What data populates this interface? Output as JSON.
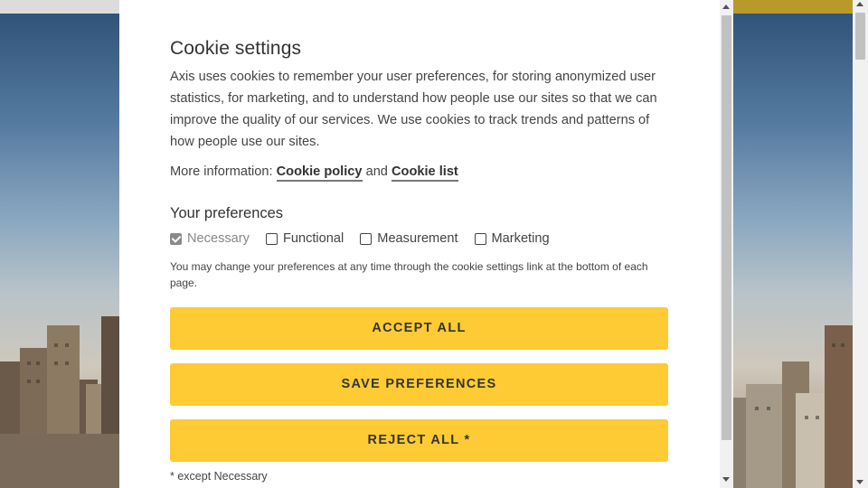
{
  "dialog": {
    "title": "Cookie settings",
    "description": "Axis uses cookies to remember your user preferences, for storing anonymized user statistics, for marketing, and to understand how people use our sites so that we can improve the quality of our services. We use cookies to track trends and patterns of how people use our sites.",
    "more_info_prefix": "More information:",
    "cookie_policy_link": "Cookie policy",
    "and_text": "and",
    "cookie_list_link": "Cookie list",
    "preferences_title": "Your preferences",
    "preferences": [
      {
        "label": "Necessary",
        "checked": true,
        "disabled": true
      },
      {
        "label": "Functional",
        "checked": false,
        "disabled": false
      },
      {
        "label": "Measurement",
        "checked": false,
        "disabled": false
      },
      {
        "label": "Marketing",
        "checked": false,
        "disabled": false
      }
    ],
    "note": "You may change your preferences at any time through the cookie settings link at the bottom of each page.",
    "accept_all_label": "ACCEPT ALL",
    "save_preferences_label": "SAVE PREFERENCES",
    "reject_all_label": "REJECT ALL *",
    "footnote": "* except Necessary"
  },
  "colors": {
    "button_yellow": "#fecb34",
    "text": "#333333",
    "header_bar": "#b89a2a"
  },
  "icons": [
    "checkbox-checked-icon",
    "checkbox-empty-icon",
    "scroll-up-arrow-icon",
    "scroll-down-arrow-icon"
  ]
}
